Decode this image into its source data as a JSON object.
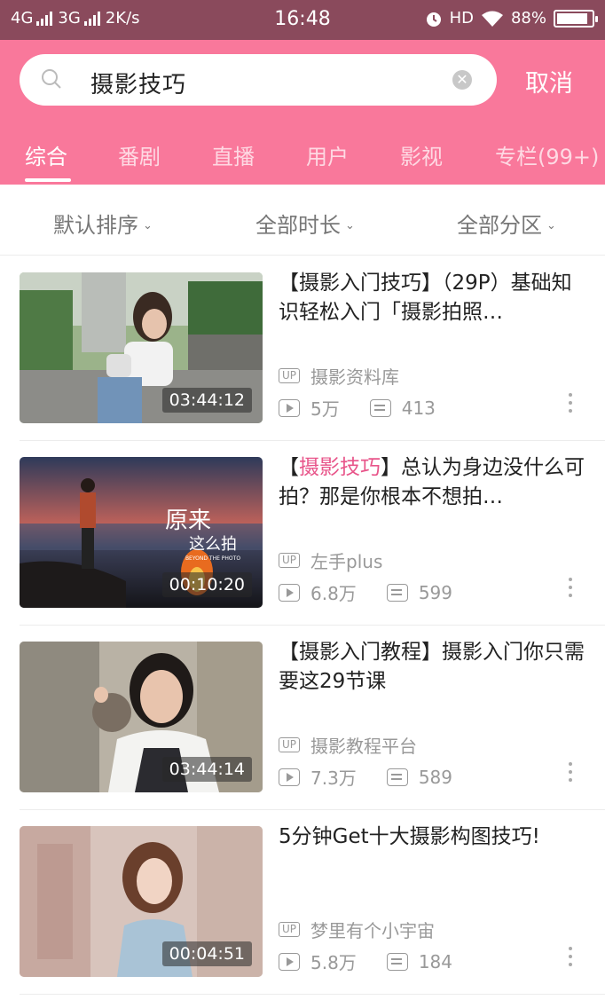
{
  "status_bar": {
    "net1": "4G",
    "net2": "3G",
    "speed": "2K/s",
    "time": "16:48",
    "hd": "HD",
    "battery": "88%",
    "battery_level": 0.88
  },
  "search": {
    "query": "摄影技巧",
    "cancel_label": "取消"
  },
  "tabs": [
    {
      "label": "综合",
      "active": true
    },
    {
      "label": "番剧"
    },
    {
      "label": "直播"
    },
    {
      "label": "用户"
    },
    {
      "label": "影视"
    },
    {
      "label": "专栏(99+)"
    }
  ],
  "filters": [
    {
      "label": "默认排序"
    },
    {
      "label": "全部时长"
    },
    {
      "label": "全部分区"
    }
  ],
  "results": [
    {
      "title_pre": "【摄影入门技巧】（29P）基础知识轻松入门「摄影拍照…",
      "title_hl": "",
      "title_post": "",
      "duration": "03:44:12",
      "up_badge": "UP",
      "uploader": "摄影资料库",
      "views": "5万",
      "danmaku": "413"
    },
    {
      "title_pre": "【",
      "title_hl": "摄影技巧",
      "title_post": "】总认为身边没什么可拍？那是你根本不想拍…",
      "duration": "00:10:20",
      "up_badge": "UP",
      "uploader": "左手plus",
      "views": "6.8万",
      "danmaku": "599",
      "overlay_text_1": "原来",
      "overlay_text_2": "这么拍",
      "overlay_text_3": "BEYOND THE PHOTO"
    },
    {
      "title_pre": "【摄影入门教程】摄影入门你只需要这29节课",
      "title_hl": "",
      "title_post": "",
      "duration": "03:44:14",
      "up_badge": "UP",
      "uploader": "摄影教程平台",
      "views": "7.3万",
      "danmaku": "589"
    },
    {
      "title_pre": "5分钟Get十大摄影构图技巧!",
      "title_hl": "",
      "title_post": "",
      "duration": "00:04:51",
      "up_badge": "UP",
      "uploader": "梦里有个小宇宙",
      "views": "5.8万",
      "danmaku": "184"
    }
  ],
  "colors": {
    "accent": "#f9789b",
    "highlight": "#e8558a",
    "status_bar": "#8a4a5c"
  }
}
